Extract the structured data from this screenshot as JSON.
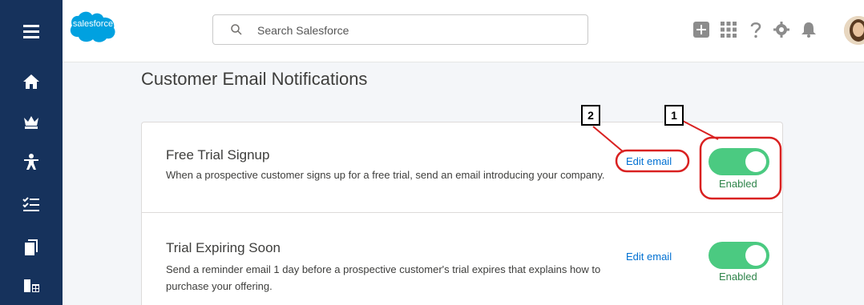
{
  "header": {
    "logo_text": "salesforce",
    "search_placeholder": "Search Salesforce"
  },
  "page": {
    "title": "Customer Email Notifications"
  },
  "rows": [
    {
      "title": "Free Trial Signup",
      "description": "When a prospective customer signs up for a free trial, send an email introducing your company.",
      "edit_label": "Edit email",
      "toggle_label": "Enabled",
      "enabled": true
    },
    {
      "title": "Trial Expiring Soon",
      "description": "Send a reminder email 1 day before a prospective customer's trial expires that explains how to purchase your offering.",
      "edit_label": "Edit email",
      "toggle_label": "Enabled",
      "enabled": true
    }
  ],
  "callouts": {
    "one": "1",
    "two": "2"
  },
  "colors": {
    "nav_bg": "#16325c",
    "brand_blue": "#00a1e0",
    "toggle_on": "#4bca81",
    "link": "#0070d2",
    "callout_red": "#d92121"
  },
  "icons": {
    "nav": [
      "menu-icon",
      "home-icon",
      "crown-icon",
      "person-icon",
      "checklist-icon",
      "documents-icon",
      "grid-table-icon"
    ],
    "header": [
      "add-icon",
      "app-launcher-icon",
      "help-icon",
      "settings-icon",
      "notifications-icon"
    ]
  }
}
